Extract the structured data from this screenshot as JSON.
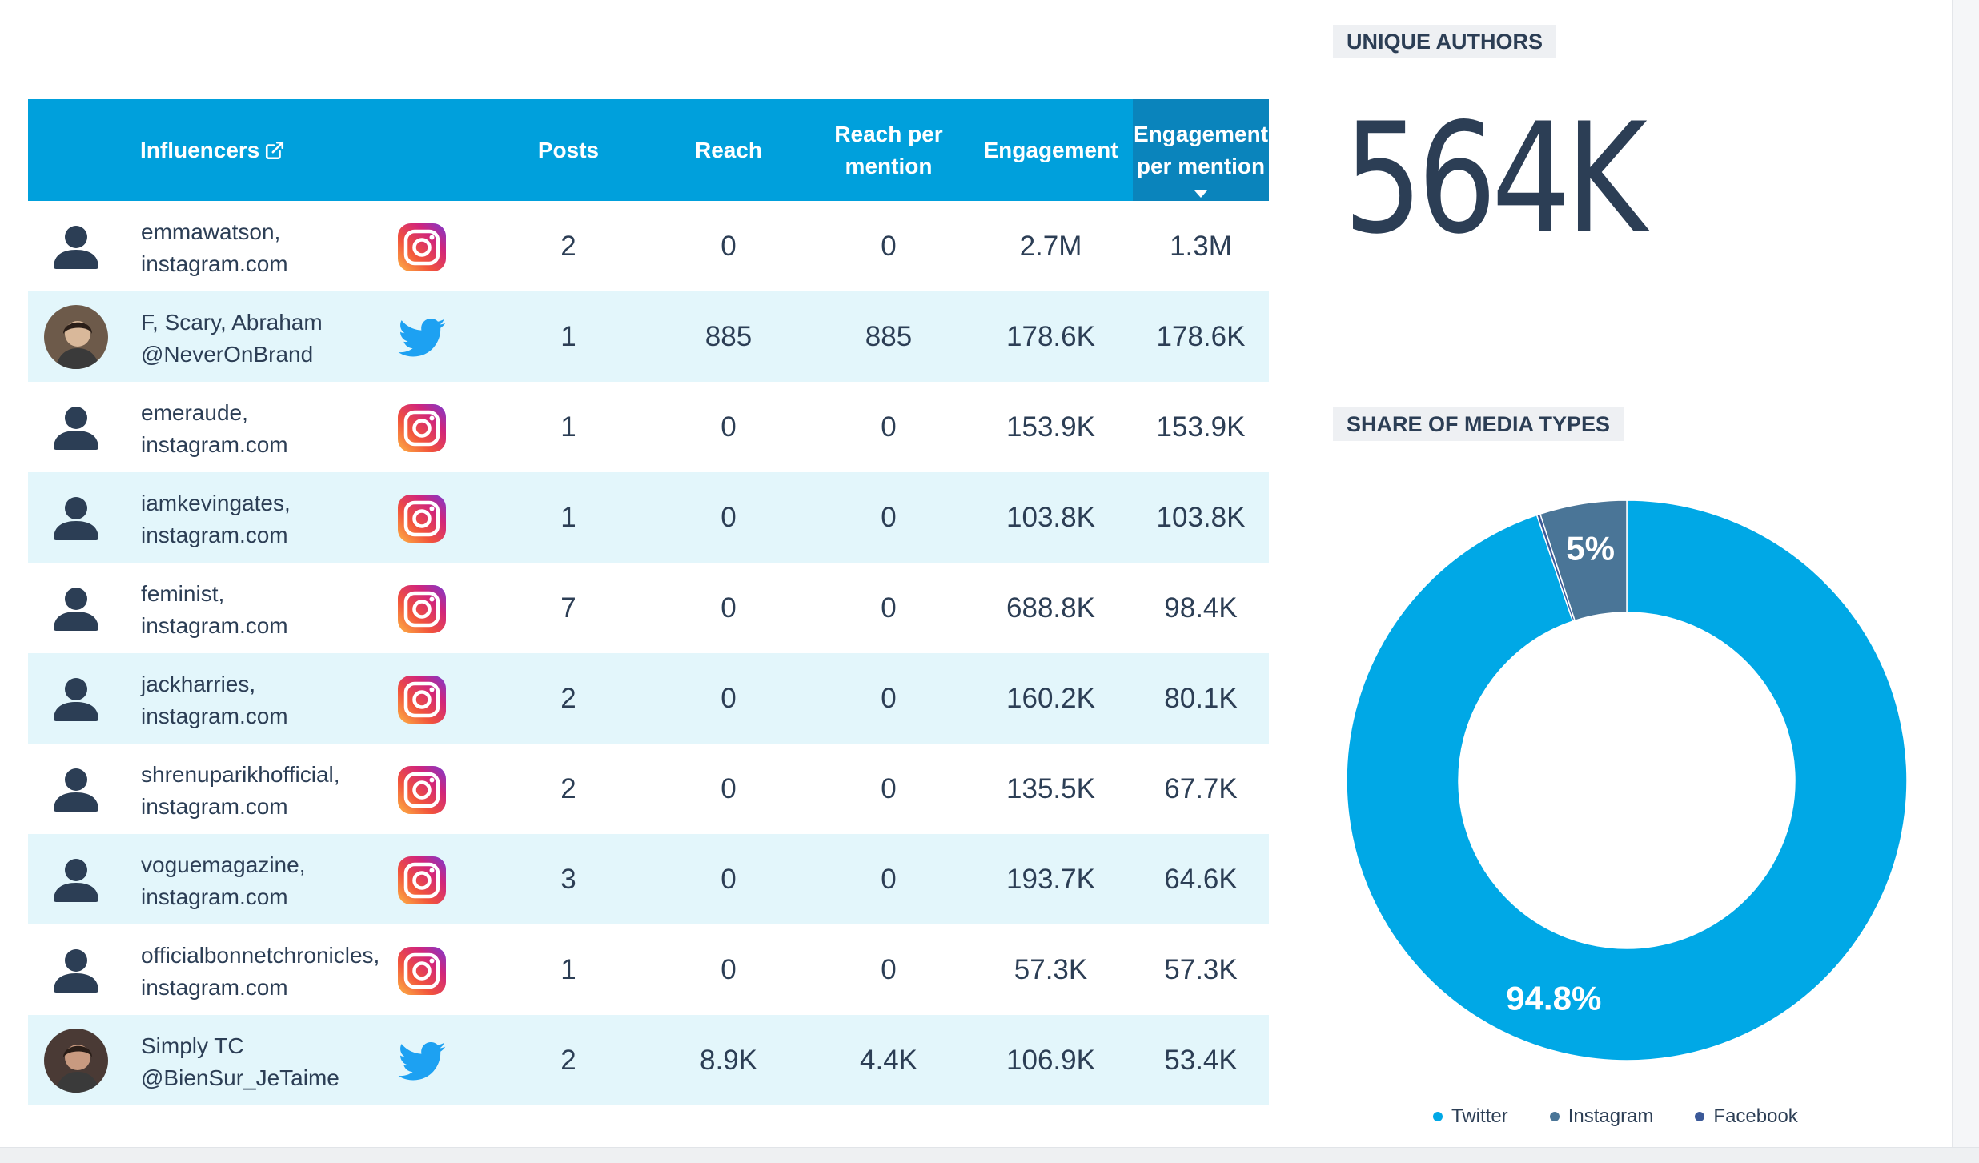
{
  "table": {
    "columns": {
      "influencers": "Influencers",
      "posts": "Posts",
      "reach": "Reach",
      "reach_per_mention_1": "Reach per",
      "reach_per_mention_2": "mention",
      "engagement": "Engagement",
      "engagement_per_mention_1": "Engagement",
      "engagement_per_mention_2": "per mention"
    },
    "sorted_column": "Engagement per mention",
    "rows": [
      {
        "name": "emmawatson,",
        "handle": "instagram.com",
        "network": "instagram",
        "avatar": "placeholder",
        "posts": "2",
        "reach": "0",
        "reach_per_mention": "0",
        "engagement": "2.7M",
        "engagement_per_mention": "1.3M"
      },
      {
        "name": "F, Scary, Abraham",
        "handle": "@NeverOnBrand",
        "network": "twitter",
        "avatar": "photo",
        "posts": "1",
        "reach": "885",
        "reach_per_mention": "885",
        "engagement": "178.6K",
        "engagement_per_mention": "178.6K"
      },
      {
        "name": "emeraude,",
        "handle": "instagram.com",
        "network": "instagram",
        "avatar": "placeholder",
        "posts": "1",
        "reach": "0",
        "reach_per_mention": "0",
        "engagement": "153.9K",
        "engagement_per_mention": "153.9K"
      },
      {
        "name": "iamkevingates,",
        "handle": "instagram.com",
        "network": "instagram",
        "avatar": "placeholder",
        "posts": "1",
        "reach": "0",
        "reach_per_mention": "0",
        "engagement": "103.8K",
        "engagement_per_mention": "103.8K"
      },
      {
        "name": "feminist,",
        "handle": "instagram.com",
        "network": "instagram",
        "avatar": "placeholder",
        "posts": "7",
        "reach": "0",
        "reach_per_mention": "0",
        "engagement": "688.8K",
        "engagement_per_mention": "98.4K"
      },
      {
        "name": "jackharries,",
        "handle": "instagram.com",
        "network": "instagram",
        "avatar": "placeholder",
        "posts": "2",
        "reach": "0",
        "reach_per_mention": "0",
        "engagement": "160.2K",
        "engagement_per_mention": "80.1K"
      },
      {
        "name": "shrenuparikhofficial,",
        "handle": "instagram.com",
        "network": "instagram",
        "avatar": "placeholder",
        "posts": "2",
        "reach": "0",
        "reach_per_mention": "0",
        "engagement": "135.5K",
        "engagement_per_mention": "67.7K"
      },
      {
        "name": "voguemagazine,",
        "handle": "instagram.com",
        "network": "instagram",
        "avatar": "placeholder",
        "posts": "3",
        "reach": "0",
        "reach_per_mention": "0",
        "engagement": "193.7K",
        "engagement_per_mention": "64.6K"
      },
      {
        "name": "officialbonnetchronicles,",
        "handle": "instagram.com",
        "network": "instagram",
        "avatar": "placeholder",
        "posts": "1",
        "reach": "0",
        "reach_per_mention": "0",
        "engagement": "57.3K",
        "engagement_per_mention": "57.3K"
      },
      {
        "name": "Simply TC",
        "handle": "@BienSur_JeTaime",
        "network": "twitter",
        "avatar": "photo",
        "posts": "2",
        "reach": "8.9K",
        "reach_per_mention": "4.4K",
        "engagement": "106.9K",
        "engagement_per_mention": "53.4K"
      }
    ]
  },
  "unique_authors": {
    "label": "UNIQUE AUTHORS",
    "value": "564K"
  },
  "media_types": {
    "label": "SHARE OF MEDIA TYPES",
    "slices": [
      {
        "name": "Twitter",
        "value": 94.8,
        "label": "94.8%",
        "color": "#00a8e6"
      },
      {
        "name": "Instagram",
        "value": 5.0,
        "label": "5%",
        "color": "#4a7597"
      },
      {
        "name": "Facebook",
        "value": 0.2,
        "label": "",
        "color": "#3b5998"
      }
    ]
  },
  "colors": {
    "header_bg": "#00a0dc",
    "sorted_header_bg": "#0a84bc",
    "alt_row_bg": "#e3f6fb",
    "text": "#2c3e55"
  }
}
